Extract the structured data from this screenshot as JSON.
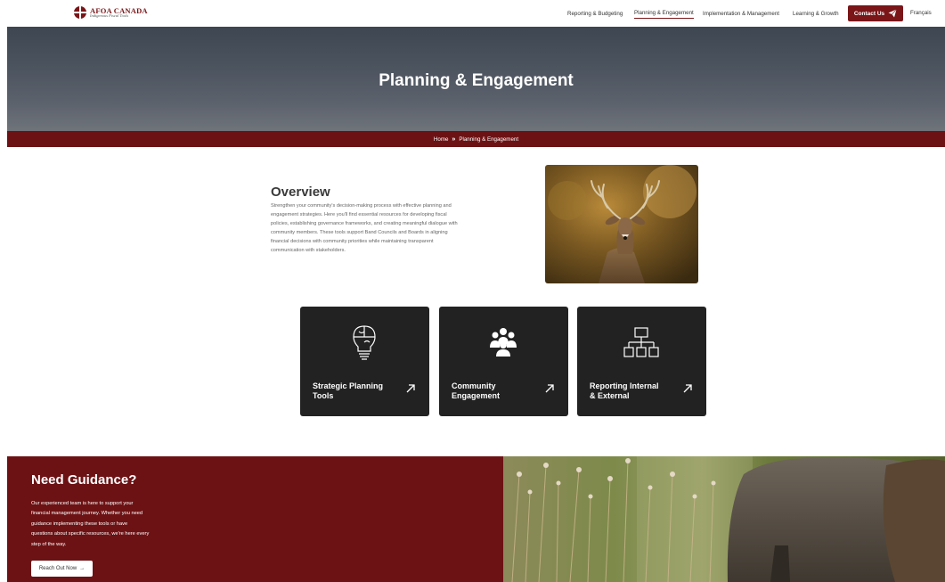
{
  "logo": {
    "title": "AFOA CANADA",
    "subtitle": "Indigenous Fiscal Tools"
  },
  "nav": {
    "items": [
      {
        "label": "Reporting & Budgeting"
      },
      {
        "label": "Planning & Engagement"
      },
      {
        "label": "Implementation & Management"
      },
      {
        "label": "Learning & Growth"
      }
    ],
    "contact_label": "Contact Us",
    "language_label": "Français"
  },
  "hero": {
    "title": "Planning & Engagement"
  },
  "breadcrumb": {
    "home": "Home",
    "current": "Planning & Engagement"
  },
  "overview": {
    "title": "Overview",
    "lines": [
      "Strengthen your community's decision-making process with effective planning and",
      "engagement strategies. Here you'll find essential resources for developing fiscal",
      "policies, establishing governance frameworks, and creating meaningful dialogue with",
      "community members. These tools support Band Councils and Boards in aligning",
      "financial decisions with community priorities while maintaining transparent",
      "communication with stakeholders."
    ]
  },
  "cards": [
    {
      "line1": "Strategic Planning",
      "line2": "Tools",
      "icon": "lightbulb-puzzle-icon"
    },
    {
      "line1": "Community",
      "line2": "Engagement",
      "icon": "people-group-icon"
    },
    {
      "line1": "Reporting Internal",
      "line2": "& External",
      "icon": "org-chart-icon"
    }
  ],
  "guidance": {
    "title": "Need Guidance?",
    "lines": [
      "Our experienced team is here to support your",
      "financial management journey. Whether you need",
      "guidance implementing these tools or have",
      "questions about specific resources, we're here every",
      "step of the way."
    ],
    "button_label": "Reach Out Now",
    "arrow": "→"
  },
  "colors": {
    "brand": "#7a1518",
    "bar": "#6d1214",
    "card": "#222222"
  }
}
